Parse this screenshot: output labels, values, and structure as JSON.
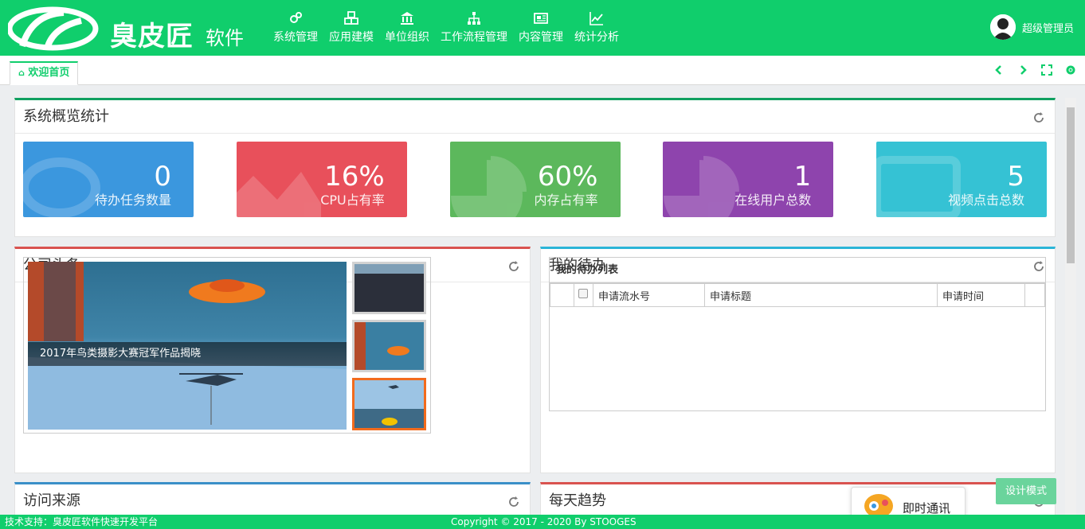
{
  "header": {
    "brand": "臭皮匠",
    "brand_sub": "软件",
    "nav": [
      {
        "label": "系统管理",
        "icon": "gears-icon"
      },
      {
        "label": "应用建模",
        "icon": "cubes-icon"
      },
      {
        "label": "单位组织",
        "icon": "bank-icon"
      },
      {
        "label": "工作流程管理",
        "icon": "sitemap-icon"
      },
      {
        "label": "内容管理",
        "icon": "newspaper-icon"
      },
      {
        "label": "统计分析",
        "icon": "line-chart-icon"
      }
    ],
    "user": "超级管理员"
  },
  "tabs": {
    "active": "欢迎首页"
  },
  "overview": {
    "title": "系统概览统计",
    "stats": [
      {
        "value": "0",
        "label": "待办任务数量",
        "color": "#3b97de"
      },
      {
        "value": "16%",
        "label": "CPU占有率",
        "color": "#e8505b"
      },
      {
        "value": "60%",
        "label": "内存占有率",
        "color": "#5cb85c"
      },
      {
        "value": "1",
        "label": "在线用户总数",
        "color": "#8e44ad"
      },
      {
        "value": "5",
        "label": "视频点击总数",
        "color": "#35c2d4"
      }
    ]
  },
  "news": {
    "title": "公司头条",
    "caption": "2017年鸟类摄影大赛冠军作品揭晓"
  },
  "todo": {
    "title": "我的待办",
    "list_title": "我的待办列表",
    "columns": [
      "申请流水号",
      "申请标题",
      "申请时间"
    ]
  },
  "visits": {
    "title": "访问来源"
  },
  "trend": {
    "title": "每天趋势"
  },
  "design_mode": "设计模式",
  "chat": "即时通讯",
  "footer": {
    "left": "技术支持：臭皮匠软件快速开发平台",
    "center": "Copyright © 2017 - 2020 By STOOGES"
  }
}
